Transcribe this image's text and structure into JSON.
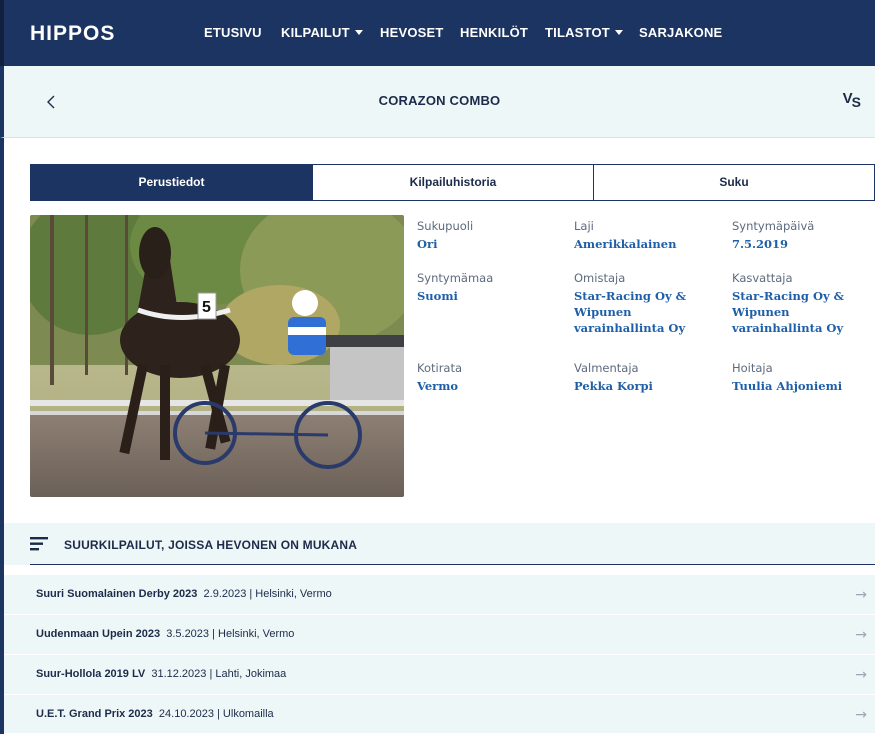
{
  "nav": {
    "logo": "HIPPOS",
    "items": [
      {
        "label": "ETUSIVU",
        "dropdown": false
      },
      {
        "label": "KILPAILUT",
        "dropdown": true
      },
      {
        "label": "HEVOSET",
        "dropdown": false
      },
      {
        "label": "HENKILÖT",
        "dropdown": false
      },
      {
        "label": "TILASTOT",
        "dropdown": true
      },
      {
        "label": "SARJAKONE",
        "dropdown": false
      }
    ]
  },
  "header": {
    "back_icon": "chevron-left-icon",
    "title": "CORAZON COMBO",
    "vs_logo_v": "V",
    "vs_logo_s": "S"
  },
  "tabs": [
    {
      "label": "Perustiedot",
      "active": true
    },
    {
      "label": "Kilpailuhistoria",
      "active": false
    },
    {
      "label": "Suku",
      "active": false
    }
  ],
  "photo": {
    "bib_number": "5"
  },
  "info": {
    "sukupuoli": {
      "label": "Sukupuoli",
      "value": "Ori"
    },
    "laji": {
      "label": "Laji",
      "value": "Amerikkalainen"
    },
    "syntymapaiva": {
      "label": "Syntymäpäivä",
      "value": "7.5.2019"
    },
    "syntymamaa": {
      "label": "Syntymämaa",
      "value": "Suomi"
    },
    "omistaja": {
      "label": "Omistaja",
      "value": "Star-Racing Oy & Wipunen varainhallinta Oy"
    },
    "kasvattaja": {
      "label": "Kasvattaja",
      "value": "Star-Racing Oy & Wipunen varainhallinta Oy"
    },
    "kotirata": {
      "label": "Kotirata",
      "value": "Vermo"
    },
    "valmentaja": {
      "label": "Valmentaja",
      "value": "Pekka Korpi"
    },
    "hoitaja": {
      "label": "Hoitaja",
      "value": "Tuulia Ahjoniemi"
    }
  },
  "races": {
    "title": "SUURKILPAILUT, JOISSA HEVONEN ON MUKANA",
    "icon": "menu-lines-icon",
    "items": [
      {
        "name": "Suuri Suomalainen Derby 2023",
        "details": "2.9.2023 | Helsinki, Vermo"
      },
      {
        "name": "Uudenmaan Upein 2023",
        "details": "3.5.2023 | Helsinki, Vermo"
      },
      {
        "name": "Suur-Hollola 2019 LV",
        "details": "31.12.2023 | Lahti, Jokimaa"
      },
      {
        "name": "U.E.T. Grand Prix 2023",
        "details": "24.10.2023 | Ulkomailla"
      }
    ],
    "arrow": "→"
  },
  "colors": {
    "navy": "#1b3462",
    "link_blue": "#1f5fa8",
    "light_bg": "#eef7f7"
  }
}
